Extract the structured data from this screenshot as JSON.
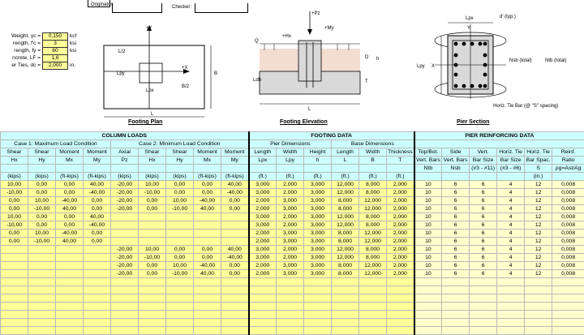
{
  "header": {
    "originator_label": "Originator:",
    "checker_label": "Checker:"
  },
  "inputs": [
    {
      "label": "Weight, γc =",
      "value": "0,150",
      "unit": "kcf"
    },
    {
      "label": "rength, f'c =",
      "value": "3",
      "unit": "ksi"
    },
    {
      "label": "rength, fy =",
      "value": "60",
      "unit": "ksi"
    },
    {
      "label": "ncrete, LF =",
      "value": "1,6",
      "unit": ""
    },
    {
      "label": "er Ties, dc =",
      "value": "2,000",
      "unit": "in."
    }
  ],
  "plan": {
    "title": "Footing Plan",
    "labels": [
      "+Y",
      "+X",
      "L/2",
      "Lpy",
      "Lpx",
      "B/2",
      "B",
      "L"
    ]
  },
  "elevation": {
    "title": "Footing Elevation",
    "labels": [
      "+Pz",
      "+My",
      "Q",
      "+Hx",
      "D",
      "h",
      "T",
      "Ldh",
      "L"
    ]
  },
  "section": {
    "title": "Pier Section",
    "labels": [
      "Lpx",
      "d' (typ.)",
      "Y",
      "X",
      "Lpy",
      "Nsb (total)",
      "Ntb (total)",
      "Horiz. Tie Bar (@ \"S\" spacing)"
    ]
  },
  "table": {
    "group_headers": [
      "COLUMN LOADS",
      "FOOTING DATA",
      "PIER REINFORCING DATA"
    ],
    "sub_headers": [
      "Case 1: Maximum Load Condition",
      "Case 2: Minimum Load Condition",
      "Pier Dimensions",
      "Base Dimensions"
    ],
    "col_heads": [
      "Shear",
      "Shear",
      "Moment",
      "Moment",
      "Axial",
      "Shear",
      "Shear",
      "Moment",
      "Moment",
      "Length",
      "Width",
      "Height",
      "Length",
      "Width",
      "Thickness",
      "Top/Bot.",
      "Side",
      "Vert.",
      "Horiz. Tie",
      "Horiz. Tie",
      "Reinf."
    ],
    "col_heads2": [
      "Hx",
      "Hy",
      "Mx",
      "My",
      "Pz",
      "Hx",
      "Hy",
      "Mx",
      "My",
      "Lpx",
      "Lpy",
      "h",
      "L",
      "B",
      "T",
      "Vert. Bars",
      "Vert. Bars",
      "Bar Size",
      "Bar Size",
      "Bar Spac.",
      "Ratio"
    ],
    "col_heads3": [
      "",
      "",
      "",
      "",
      "",
      "",
      "",
      "",
      "",
      "",
      "",
      "",
      "",
      "",
      "",
      "Ntb",
      "Nsb",
      "(#3 - #11)",
      "(#3 - #6)",
      "S",
      "ρg=Ast/Ag"
    ],
    "units": [
      "(kips)",
      "(kips)",
      "(ft-kips)",
      "(ft-kips)",
      "(kips)",
      "(kips)",
      "(kips)",
      "(ft-kips)",
      "(ft-kips)",
      "(ft.)",
      "(ft.)",
      "(ft.)",
      "(ft.)",
      "(ft.)",
      "(ft.)",
      "",
      "",
      "",
      "",
      "(in.)",
      ""
    ],
    "rows": [
      [
        "10,00",
        "0,00",
        "0,00",
        "40,00",
        "-20,00",
        "10,00",
        "0,00",
        "0,00",
        "40,00",
        "3,000",
        "2,000",
        "3,000",
        "12,000",
        "8,000",
        "2,000",
        "10",
        "6",
        "6",
        "4",
        "12",
        "0,008"
      ],
      [
        "-10,00",
        "0,00",
        "0,00",
        "-40,00",
        "-20,00",
        "-10,00",
        "0,00",
        "0,00",
        "-40,00",
        "3,000",
        "2,000",
        "3,000",
        "12,000",
        "8,000",
        "2,000",
        "10",
        "6",
        "6",
        "4",
        "12",
        "0,008"
      ],
      [
        "0,00",
        "10,00",
        "-40,00",
        "0,00",
        "-20,00",
        "0,00",
        "10,00",
        "-40,00",
        "0,00",
        "2,000",
        "3,000",
        "3,000",
        "8,000",
        "12,000",
        "2,000",
        "10",
        "6",
        "6",
        "4",
        "12",
        "0,008"
      ],
      [
        "0,00",
        "-10,00",
        "40,00",
        "0,00",
        "-20,00",
        "0,00",
        "-10,00",
        "40,00",
        "0,00",
        "2,000",
        "3,000",
        "3,000",
        "8,000",
        "12,000",
        "2,000",
        "10",
        "6",
        "6",
        "4",
        "12",
        "0,008"
      ],
      [
        "10,00",
        "0,00",
        "0,00",
        "40,00",
        "",
        "",
        "",
        "",
        "",
        "3,000",
        "2,000",
        "3,000",
        "12,000",
        "8,000",
        "2,000",
        "10",
        "6",
        "6",
        "4",
        "12",
        "0,008"
      ],
      [
        "-10,00",
        "0,00",
        "0,00",
        "-40,00",
        "",
        "",
        "",
        "",
        "",
        "3,000",
        "2,000",
        "3,000",
        "12,000",
        "8,000",
        "2,000",
        "10",
        "6",
        "6",
        "4",
        "12",
        "0,008"
      ],
      [
        "0,00",
        "10,00",
        "-40,00",
        "0,00",
        "",
        "",
        "",
        "",
        "",
        "2,000",
        "3,000",
        "3,000",
        "8,000",
        "12,000",
        "2,000",
        "10",
        "6",
        "6",
        "4",
        "12",
        "0,008"
      ],
      [
        "0,00",
        "-10,00",
        "40,00",
        "0,00",
        "",
        "",
        "",
        "",
        "",
        "2,000",
        "3,000",
        "3,000",
        "8,000",
        "12,000",
        "2,000",
        "10",
        "6",
        "6",
        "4",
        "12",
        "0,008"
      ],
      [
        "",
        "",
        "",
        "",
        "-20,00",
        "10,00",
        "0,00",
        "0,00",
        "40,00",
        "3,000",
        "2,000",
        "3,000",
        "12,000",
        "8,000",
        "2,000",
        "10",
        "6",
        "6",
        "4",
        "12",
        "0,008"
      ],
      [
        "",
        "",
        "",
        "",
        "-20,00",
        "-10,00",
        "0,00",
        "0,00",
        "-40,00",
        "3,000",
        "2,000",
        "3,000",
        "12,000",
        "8,000",
        "2,000",
        "10",
        "6",
        "6",
        "4",
        "12",
        "0,008"
      ],
      [
        "",
        "",
        "",
        "",
        "-20,00",
        "0,00",
        "10,00",
        "-40,00",
        "0,00",
        "2,000",
        "3,000",
        "3,000",
        "8,000",
        "12,000",
        "2,000",
        "10",
        "6",
        "6",
        "4",
        "12",
        "0,008"
      ],
      [
        "",
        "",
        "",
        "",
        "-20,00",
        "0,00",
        "-10,00",
        "40,00",
        "0,00",
        "2,000",
        "3,000",
        "3,000",
        "8,000",
        "12,000",
        "2,000",
        "10",
        "6",
        "6",
        "4",
        "12",
        "0,008"
      ]
    ]
  }
}
